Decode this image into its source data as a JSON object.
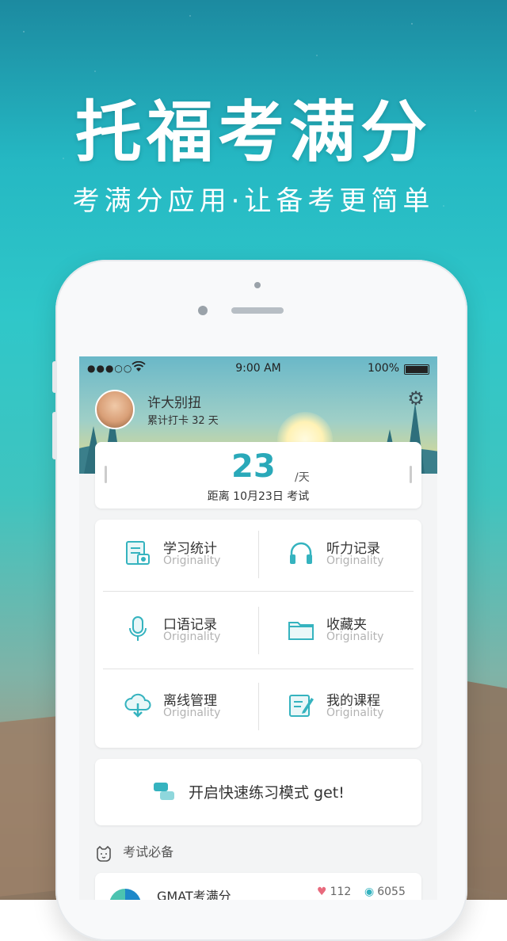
{
  "hero": {
    "title": "托福考满分",
    "subtitle": "考满分应用·让备考更简单"
  },
  "status_bar": {
    "signal": "●●●○○",
    "time": "9:00 AM",
    "battery": "100%"
  },
  "profile": {
    "name": "许大别扭",
    "checkin": "累计打卡 32 天"
  },
  "countdown": {
    "days": "23",
    "unit": "/天",
    "description": "距离 10月23日 考试"
  },
  "features": [
    {
      "label": "学习统计",
      "sub": "Originality",
      "icon": "document-chart-icon"
    },
    {
      "label": "听力记录",
      "sub": "Originality",
      "icon": "headphones-icon"
    },
    {
      "label": "口语记录",
      "sub": "Originality",
      "icon": "microphone-icon"
    },
    {
      "label": "收藏夹",
      "sub": "Originality",
      "icon": "folder-icon"
    },
    {
      "label": "离线管理",
      "sub": "Originality",
      "icon": "cloud-download-icon"
    },
    {
      "label": "我的课程",
      "sub": "Originality",
      "icon": "edit-note-icon"
    }
  ],
  "quick_mode": {
    "label": "开启快速练习模式 get!"
  },
  "section": {
    "title": "考试必备"
  },
  "list": [
    {
      "name": "GMAT考满分",
      "likes": "112",
      "views": "6055"
    }
  ],
  "colors": {
    "accent": "#35b3bf",
    "countdown": "#2aa9b9"
  }
}
